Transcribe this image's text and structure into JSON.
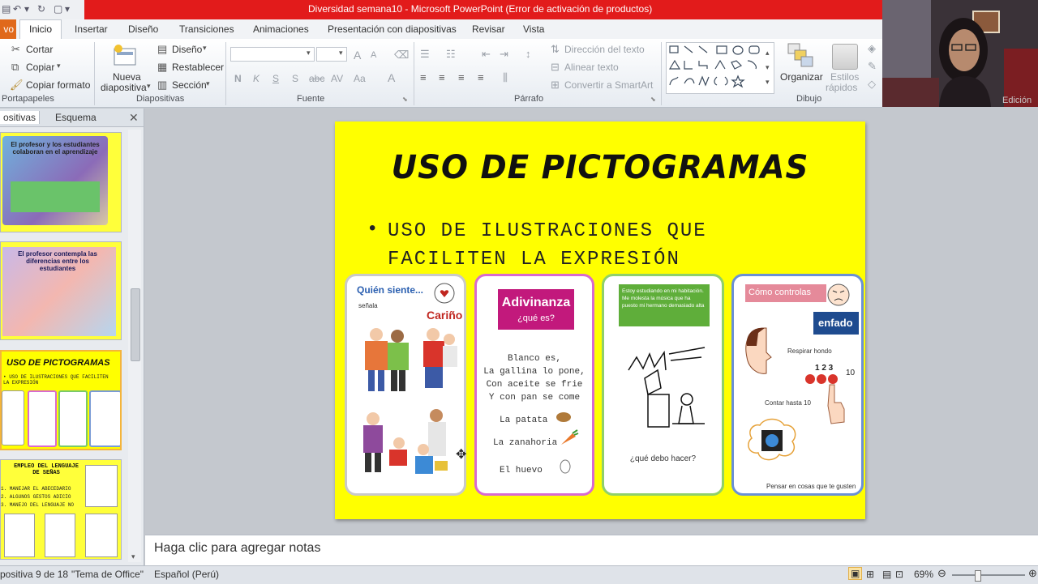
{
  "window": {
    "title": "Diversidad semana10  -  Microsoft PowerPoint (Error de activación de productos)"
  },
  "tabs": {
    "file": "vo",
    "items": [
      "Inicio",
      "Insertar",
      "Diseño",
      "Transiciones",
      "Animaciones",
      "Presentación con diapositivas",
      "Revisar",
      "Vista"
    ]
  },
  "ribbon": {
    "clipboard": {
      "cut": "Cortar",
      "copy": "Copiar",
      "format_painter": "Copiar formato",
      "label": "Portapapeles"
    },
    "slides": {
      "new_slide_1": "Nueva",
      "new_slide_2": "diapositiva",
      "layout": "Diseño",
      "reset": "Restablecer",
      "section": "Sección",
      "label": "Diapositivas"
    },
    "font": {
      "label": "Fuente",
      "bold": "N",
      "italic": "K",
      "underline": "S",
      "strike": "abc",
      "spacing": "AV",
      "case": "Aa",
      "color": "A",
      "grow": "A",
      "shrink": "A"
    },
    "paragraph": {
      "text_direction": "Dirección del texto",
      "align_text": "Alinear texto",
      "smartart": "Convertir a SmartArt",
      "label": "Párrafo"
    },
    "drawing": {
      "arrange": "Organizar",
      "styles_1": "Estilos",
      "styles_2": "rápidos",
      "label": "Dibujo"
    },
    "editing": {
      "label": "Edición"
    }
  },
  "panel": {
    "tab_slides": "ositivas",
    "tab_outline": "Esquema"
  },
  "thumbnails": [
    {
      "title": "El profesor y los estudiantes colaboran en el aprendizaje"
    },
    {
      "title": "El profesor contempla las diferencias entre los estudiantes"
    },
    {
      "title": "USO DE PICTOGRAMAS",
      "sub": "• USO DE ILUSTRACIONES QUE FACILITEN LA EXPRESIÓN"
    },
    {
      "title": "EMPLEO DEL LENGUAJE DE SEÑAS",
      "items": [
        "1. MANEJAR EL ABECEDARIO",
        "2. ALGUNOS GESTOS ADICIO",
        "3. MANEJO DEL LENGUAJE NO"
      ]
    }
  ],
  "slide": {
    "title": "USO DE PICTOGRAMAS",
    "bullet_line1": "USO DE ILUSTRACIONES QUE",
    "bullet_line2": "FACILITEN LA EXPRESIÓN",
    "card1": {
      "header": "Quién siente...",
      "sub": "señala",
      "word": "Cariño"
    },
    "card2": {
      "header1": "Adivinanza",
      "header2": "¿qué es?",
      "riddle": [
        "Blanco es,",
        "La gallina lo pone,",
        "Con aceite se frie",
        "Y con pan se come"
      ],
      "options": [
        "La patata",
        "La zanahoria",
        "El huevo"
      ]
    },
    "card3": {
      "situation": "Estoy estudiando en mi habitación. Me molesta la música que ha puesto mi hermano demasiado alta",
      "question": "¿qué debo hacer?"
    },
    "card4": {
      "header": "Cómo controlas",
      "emotion": "enfado",
      "step1": "Respirar hondo",
      "numbers": "1  2  3",
      "ten": "10",
      "step2": "Contar hasta 10",
      "step3": "Pensar en cosas que te gusten"
    }
  },
  "notes": {
    "placeholder": "Haga clic para agregar notas"
  },
  "status": {
    "slide": "positiva 9 de 18",
    "theme": "\"Tema de Office\"",
    "language": "Español (Perú)",
    "zoom": "69%"
  }
}
